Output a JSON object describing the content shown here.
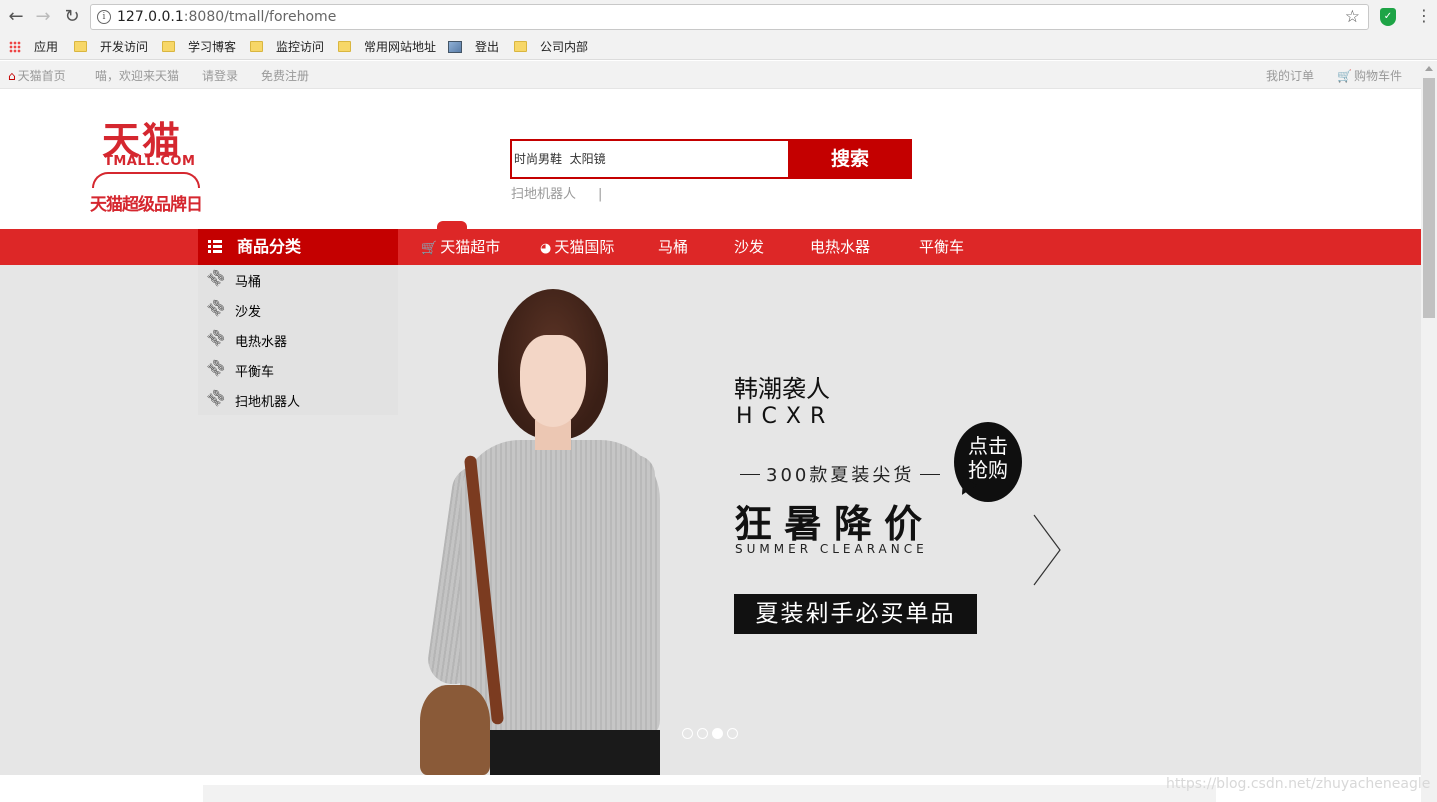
{
  "browser": {
    "url_host": "127.0.0.1",
    "url_rest": ":8080/tmall/forehome",
    "bookmarks": [
      {
        "label": "应用",
        "icon": "apps-grid-icon"
      },
      {
        "label": "开发访问",
        "icon": "folder-icon"
      },
      {
        "label": "学习博客",
        "icon": "folder-icon"
      },
      {
        "label": "监控访问",
        "icon": "folder-icon"
      },
      {
        "label": "常用网站地址",
        "icon": "folder-icon"
      },
      {
        "label": "登出",
        "icon": "image-icon"
      },
      {
        "label": "公司内部",
        "icon": "folder-icon"
      }
    ]
  },
  "topbar": {
    "home": "天猫首页",
    "welcome": "喵，欢迎来天猫",
    "login": "请登录",
    "register": "免费注册",
    "orders": "我的订单",
    "cart": "购物车件"
  },
  "logo": {
    "cn": "天猫",
    "en": "TMALL.COM",
    "promo": "天猫超级品牌日"
  },
  "search": {
    "placeholder": "时尚男鞋  太阳镜",
    "button": "搜索",
    "hotwords": [
      "扫地机器人"
    ],
    "separator": "|"
  },
  "nav": {
    "category_label": "商品分类",
    "items": [
      {
        "label": "天猫超市",
        "icon": "cart-icon"
      },
      {
        "label": "天猫国际",
        "icon": "globe-icon"
      },
      {
        "label": "马桶"
      },
      {
        "label": "沙发"
      },
      {
        "label": "电热水器"
      },
      {
        "label": "平衡车"
      }
    ]
  },
  "categories": [
    "马桶",
    "沙发",
    "电热水器",
    "平衡车",
    "扫地机器人"
  ],
  "banner": {
    "title": "韩潮袭人",
    "code": "HCXR",
    "subtitle": "300款夏装尖货",
    "headline": "狂暑降价",
    "english": "SUMMER CLEARANCE",
    "bubble_line1": "点击",
    "bubble_line2": "抢购",
    "cta": "夏装剁手必买单品",
    "slide_count": 4,
    "active_slide": 3
  },
  "watermark": "https://blog.csdn.net/zhuyacheneagle",
  "colors": {
    "brand_red": "#dd2727",
    "dark_red": "#c40000",
    "banner_bg": "#e6e6e6"
  }
}
